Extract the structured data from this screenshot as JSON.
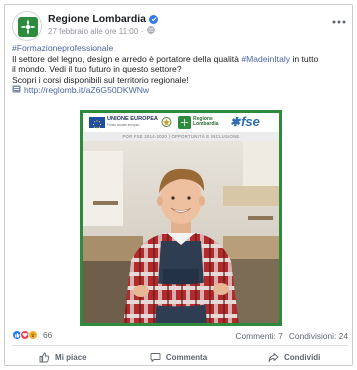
{
  "post": {
    "page_name": "Regione Lombardia",
    "timestamp": "27 febbraio alle ore 11:00",
    "hashtag": "#Formazioneprofessionale",
    "text_line1_a": "Il settore del legno, design e arredo è portatore della qualità ",
    "text_line1_tag": "#MadeinItaly",
    "text_line1_b": " in tutto",
    "text_line2": "il mondo. Vedi il tuo futuro in questo settore?",
    "text_line3": "Scopri i corsi disponibili sul territorio regionale!",
    "link": "http://reglomb.it/aZ6G50DKWNw"
  },
  "image": {
    "eu_label": "UNIONE EUROPEA",
    "eu_sub": "Fondo sociale europeo",
    "rl_label_1": "Regione",
    "rl_label_2": "Lombardia",
    "fse_label": "fse",
    "program_label": "POR FSE 2014-2020 | OPPORTUNITÀ E INCLUSIONE",
    "border_color": "#2e8b3e"
  },
  "stats": {
    "reaction_count": "66",
    "comments": "Commenti: 7",
    "shares": "Condivisioni: 24"
  },
  "actions": {
    "like": "Mi piace",
    "comment": "Commenta",
    "share": "Condividi"
  },
  "icons": [
    "verified-icon",
    "globe-icon",
    "more-icon",
    "link-icon",
    "like-reaction-icon",
    "love-reaction-icon",
    "wow-reaction-icon",
    "like-icon",
    "comment-icon",
    "share-icon"
  ]
}
